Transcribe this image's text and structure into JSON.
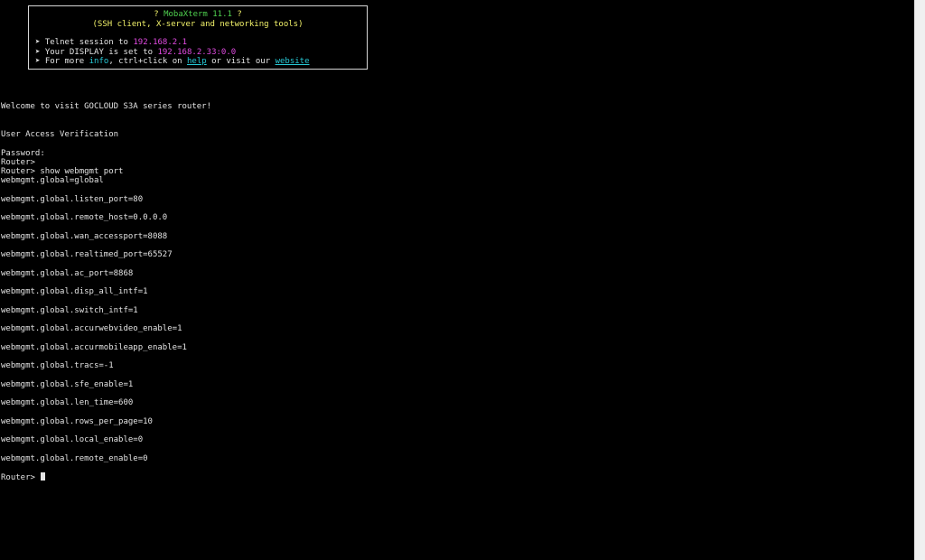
{
  "colors": {
    "background": "#000000",
    "text": "#e4e4e4",
    "banner_title": "#4fd14f",
    "banner_subtitle": "#f2f26a",
    "highlight_magenta": "#e24be2",
    "highlight_cyan": "#27c9d6"
  },
  "banner": {
    "title_prefix": "? ",
    "title_app": "MobaXterm 11.1",
    "title_suffix": " ?",
    "subtitle": "(SSH client, X-server and networking tools)",
    "line1_text": "Telnet session to ",
    "line1_value": "192.168.2.1",
    "line2_text": "Your DISPLAY is set to ",
    "line2_value": "192.168.2.33:0.0",
    "line3_a": "For more ",
    "line3_info": "info",
    "line3_b": ", ctrl+click on ",
    "line3_help": "help",
    "line3_c": " or visit our ",
    "line3_website": "website",
    "bullet": "➤"
  },
  "session": {
    "welcome": "Welcome to visit GOCLOUD S3A series router!",
    "verification": "User Access Verification",
    "password_prompt": "Password:",
    "prompt1": "Router>",
    "prompt2_cmd": "Router> show webmgmt port",
    "output": [
      "webmgmt.global=global",
      "webmgmt.global.listen_port=80",
      "webmgmt.global.remote_host=0.0.0.0",
      "webmgmt.global.wan_accessport=8088",
      "webmgmt.global.realtimed_port=65527",
      "webmgmt.global.ac_port=8868",
      "webmgmt.global.disp_all_intf=1",
      "webmgmt.global.switch_intf=1",
      "webmgmt.global.accurwebvideo_enable=1",
      "webmgmt.global.accurmobileapp_enable=1",
      "webmgmt.global.tracs=-1",
      "webmgmt.global.sfe_enable=1",
      "webmgmt.global.len_time=600",
      "webmgmt.global.rows_per_page=10",
      "webmgmt.global.local_enable=0",
      "webmgmt.global.remote_enable=0"
    ],
    "final_prompt": "Router>"
  }
}
